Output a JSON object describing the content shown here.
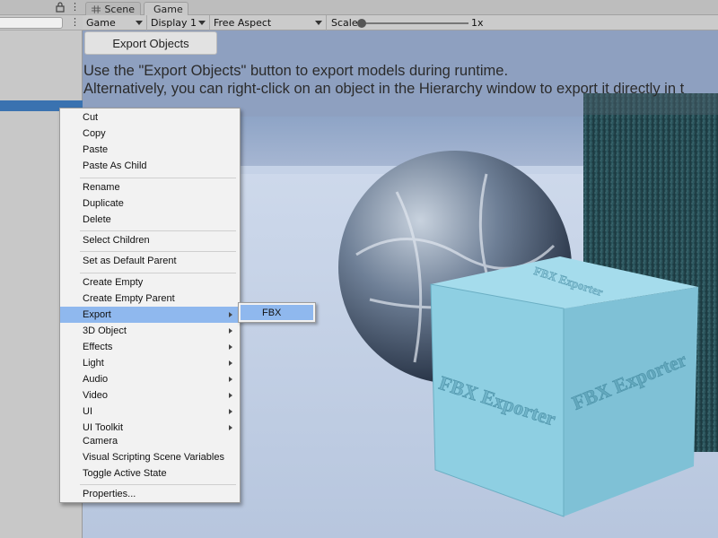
{
  "tabs": [
    {
      "label": "Scene",
      "icon": "grid-icon"
    },
    {
      "label": "Game",
      "icon": "gamepad-icon"
    }
  ],
  "toolbar": {
    "view_select": "Game",
    "display_select": "Display 1",
    "aspect_select": "Free Aspect",
    "scale_label": "Scale",
    "scale_value": "1x",
    "scale_level": 0.0
  },
  "game": {
    "export_button_label": "Export Objects",
    "info_line_1": "Use the \"Export Objects\" button to export models during runtime.",
    "info_line_2": "Alternatively, you can right-click on an object in the Hierarchy window to export it directly in t",
    "cube_front_text": "FBX Exporter",
    "cube_side_text": "FBX Exporter",
    "cube_top_text": "FBX Exporter"
  },
  "context_menu": {
    "items": [
      {
        "label": "Cut",
        "submenu": false
      },
      {
        "label": "Copy",
        "submenu": false
      },
      {
        "label": "Paste",
        "submenu": false
      },
      {
        "label": "Paste As Child",
        "submenu": false
      },
      {
        "label": "Rename",
        "submenu": false
      },
      {
        "label": "Duplicate",
        "submenu": false
      },
      {
        "label": "Delete",
        "submenu": false
      },
      {
        "label": "Select Children",
        "submenu": false
      },
      {
        "label": "Set as Default Parent",
        "submenu": false
      },
      {
        "label": "Create Empty",
        "submenu": false
      },
      {
        "label": "Create Empty Parent",
        "submenu": false
      },
      {
        "label": "Export",
        "submenu": true,
        "highlighted": true
      },
      {
        "label": "3D Object",
        "submenu": true
      },
      {
        "label": "Effects",
        "submenu": true
      },
      {
        "label": "Light",
        "submenu": true
      },
      {
        "label": "Audio",
        "submenu": true
      },
      {
        "label": "Video",
        "submenu": true
      },
      {
        "label": "UI",
        "submenu": true
      },
      {
        "label": "UI Toolkit",
        "submenu": true
      },
      {
        "label": "Camera",
        "submenu": false
      },
      {
        "label": "Visual Scripting Scene Variables",
        "submenu": false
      },
      {
        "label": "Toggle Active State",
        "submenu": false
      },
      {
        "label": "Properties...",
        "submenu": false
      }
    ],
    "submenu": {
      "label": "FBX"
    }
  },
  "colors": {
    "highlight": "#8fb8ee",
    "selection": "#3a72b0",
    "cube": "#8ecfe2",
    "sky": "#c9d6ea"
  }
}
